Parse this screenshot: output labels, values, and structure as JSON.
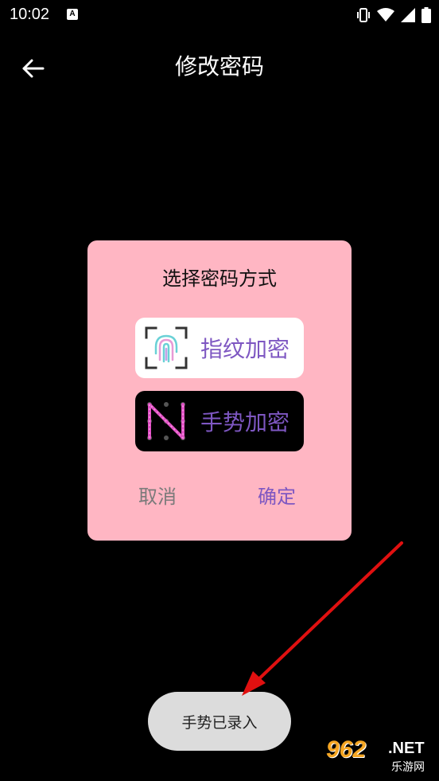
{
  "status_bar": {
    "time": "10:02",
    "notification_icon": "A",
    "icons": [
      "vibrate-icon",
      "wifi-icon",
      "signal-icon",
      "battery-icon"
    ]
  },
  "appbar": {
    "back_icon": "arrow-left-icon",
    "title": "修改密码"
  },
  "dialog": {
    "title": "选择密码方式",
    "options": [
      {
        "label": "指纹加密",
        "icon": "fingerprint-icon"
      },
      {
        "label": "手势加密",
        "icon": "gesture-pattern-icon"
      }
    ],
    "cancel_label": "取消",
    "ok_label": "确定"
  },
  "toast": {
    "text": "手势已录入"
  },
  "watermark": {
    "number": "962",
    "domain": ".NET",
    "name": "乐游网"
  },
  "colors": {
    "background": "#000000",
    "dialog_bg": "#ffb6c3",
    "accent_purple": "#7e57c2",
    "cancel_gray": "#7a7a7a",
    "toast_bg": "#dcdcdc",
    "annotation_arrow": "#e01010"
  }
}
